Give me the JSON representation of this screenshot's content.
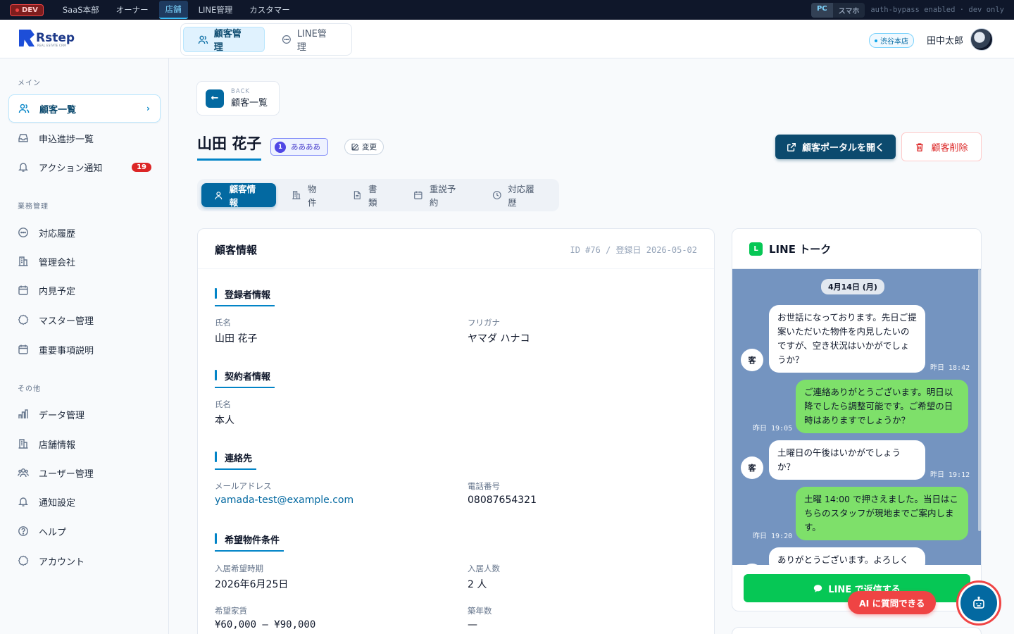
{
  "devbar": {
    "badge": "DEV",
    "tabs": [
      "SaaS本部",
      "オーナー",
      "店舗",
      "LINE管理",
      "カスタマー"
    ],
    "active_tab": "店舗",
    "device": [
      "PC",
      "スマホ"
    ],
    "note": "auth-bypass enabled · dev only"
  },
  "header": {
    "logo": "Rstep",
    "logo_sub": "REAL ESTATE CRM",
    "tabs": [
      "顧客管理",
      "LINE管理"
    ],
    "store": "渋谷本店",
    "user": "田中太郎"
  },
  "sidebar": {
    "sections": [
      {
        "title": "メイン",
        "items": [
          {
            "label": "顧客一覧",
            "icon": "users-icon"
          },
          {
            "label": "申込進捗一覧",
            "icon": "inbox-icon"
          },
          {
            "label": "アクション通知",
            "icon": "bell-icon",
            "badge": "19"
          }
        ]
      },
      {
        "title": "業務管理",
        "items": [
          {
            "label": "対応履歴",
            "icon": "chat-icon"
          },
          {
            "label": "管理会社",
            "icon": "building-icon"
          },
          {
            "label": "内見予定",
            "icon": "calendar-icon"
          },
          {
            "label": "マスター管理",
            "icon": "gear-icon"
          },
          {
            "label": "重要事項説明",
            "icon": "calendar-icon"
          }
        ]
      },
      {
        "title": "その他",
        "items": [
          {
            "label": "データ管理",
            "icon": "chart-icon"
          },
          {
            "label": "店舗情報",
            "icon": "building-icon"
          },
          {
            "label": "ユーザー管理",
            "icon": "team-icon"
          },
          {
            "label": "通知設定",
            "icon": "bell-icon"
          },
          {
            "label": "ヘルプ",
            "icon": "help-icon"
          },
          {
            "label": "アカウント",
            "icon": "gear-icon"
          }
        ]
      }
    ]
  },
  "main": {
    "back_small": "BACK",
    "back_label": "顧客一覧",
    "customer_name": "山田 花子",
    "status_num": "1",
    "status_label": "ああああ",
    "change_label": "変更",
    "portal_label": "顧客ポータルを開く",
    "delete_label": "顧客削除",
    "tabs": [
      "顧客情報",
      "物件",
      "書類",
      "重説予約",
      "対応履歴"
    ],
    "info": {
      "title": "顧客情報",
      "meta": "ID #76 / 登録日 2026-05-02",
      "registrant_h": "登録者情報",
      "name_label": "氏名",
      "name_value": "山田 花子",
      "kana_label": "フリガナ",
      "kana_value": "ヤマダ ハナコ",
      "contractor_h": "契約者情報",
      "c_name_label": "氏名",
      "c_name_value": "本人",
      "contact_h": "連絡先",
      "email_label": "メールアドレス",
      "email_value": "yamada-test@example.com",
      "phone_label": "電話番号",
      "phone_value": "08087654321",
      "pref_h": "希望物件条件",
      "move_label": "入居希望時期",
      "move_value": "2026年6月25日",
      "people_label": "入居人数",
      "people_value": "2 人",
      "rent_label": "希望家賃",
      "rent_value": "¥60,000 — ¥90,000",
      "age_label": "築年数",
      "age_value": "—"
    }
  },
  "line": {
    "logo": "L",
    "title": "LINE トーク",
    "date": "4月14日 (月)",
    "avatar": "客",
    "messages": [
      {
        "dir": "in",
        "text": "お世話になっております。先日ご提案いただいた物件を内見したいのですが、空き状況はいかがでしょうか？",
        "time": "昨日 18:42"
      },
      {
        "dir": "out",
        "text": "ご連絡ありがとうございます。明日以降でしたら調整可能です。ご希望の日時はありますでしょうか？",
        "time": "昨日 19:05"
      },
      {
        "dir": "in",
        "text": "土曜日の午後はいかがでしょうか？",
        "time": "昨日 19:12"
      },
      {
        "dir": "out",
        "text": "土曜 14:00 で押さえました。当日はこちらのスタッフが現地までご案内します。",
        "time": "昨日 19:20"
      },
      {
        "dir": "in",
        "text": "ありがとうございます。よろしく",
        "time": ""
      }
    ],
    "reply_label": "LINE で返信する"
  },
  "ai": {
    "tip": "AI に質問できる"
  }
}
